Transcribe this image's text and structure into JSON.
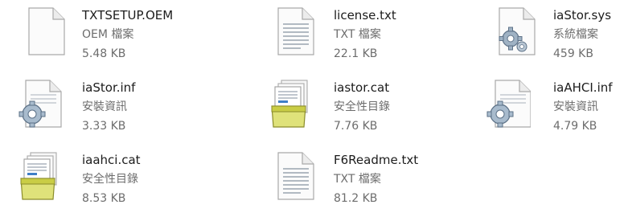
{
  "files": [
    {
      "name": "TXTSETUP.OEM",
      "type": "OEM 檔案",
      "size": "5.48 KB",
      "icon": "blank-file-icon"
    },
    {
      "name": "license.txt",
      "type": "TXT 檔案",
      "size": "22.1 KB",
      "icon": "text-file-icon"
    },
    {
      "name": "iaStor.sys",
      "type": "系統檔案",
      "size": "459 KB",
      "icon": "system-file-icon"
    },
    {
      "name": "iaStor.inf",
      "type": "安裝資訊",
      "size": "3.33 KB",
      "icon": "setup-info-icon"
    },
    {
      "name": "iastor.cat",
      "type": "安全性目錄",
      "size": "7.76 KB",
      "icon": "security-catalog-icon"
    },
    {
      "name": "iaAHCI.inf",
      "type": "安裝資訊",
      "size": "4.79 KB",
      "icon": "setup-info-icon"
    },
    {
      "name": "iaahci.cat",
      "type": "安全性目錄",
      "size": "8.53 KB",
      "icon": "security-catalog-icon"
    },
    {
      "name": "F6Readme.txt",
      "type": "TXT 檔案",
      "size": "81.2 KB",
      "icon": "text-file-icon"
    }
  ]
}
